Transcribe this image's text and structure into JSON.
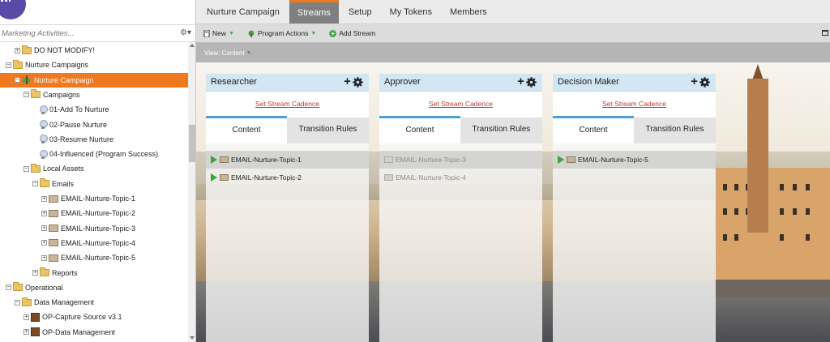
{
  "sidebar": {
    "search_placeholder": "Marketing Activities...",
    "tree": [
      {
        "label": "DO NOT MODIFY!",
        "indent": 2,
        "icon": "folder",
        "toggle": "+"
      },
      {
        "label": "Nurture Campaigns",
        "indent": 1,
        "icon": "folder",
        "toggle": "-"
      },
      {
        "label": "Nurture Campaign",
        "indent": 2,
        "icon": "nurture",
        "toggle": "-",
        "selected": true
      },
      {
        "label": "Campaigns",
        "indent": 3,
        "icon": "folder",
        "toggle": "-"
      },
      {
        "label": "01-Add To Nurture",
        "indent": 4,
        "icon": "bulb"
      },
      {
        "label": "02-Pause Nurture",
        "indent": 4,
        "icon": "bulb"
      },
      {
        "label": "03-Resume Nurture",
        "indent": 4,
        "icon": "bulb"
      },
      {
        "label": "04-Influenced (Program Success)",
        "indent": 4,
        "icon": "bulb"
      },
      {
        "label": "Local Assets",
        "indent": 3,
        "icon": "folder",
        "toggle": "-"
      },
      {
        "label": "Emails",
        "indent": 4,
        "icon": "folder",
        "toggle": "-"
      },
      {
        "label": "EMAIL-Nurture-Topic-1",
        "indent": 5,
        "icon": "email",
        "toggle": "+"
      },
      {
        "label": "EMAIL-Nurture-Topic-2",
        "indent": 5,
        "icon": "email",
        "toggle": "+"
      },
      {
        "label": "EMAIL-Nurture-Topic-3",
        "indent": 5,
        "icon": "email",
        "toggle": "+"
      },
      {
        "label": "EMAIL-Nurture-Topic-4",
        "indent": 5,
        "icon": "email",
        "toggle": "+"
      },
      {
        "label": "EMAIL-Nurture-Topic-5",
        "indent": 5,
        "icon": "email",
        "toggle": "+"
      },
      {
        "label": "Reports",
        "indent": 4,
        "icon": "folder",
        "toggle": "+"
      },
      {
        "label": "Operational",
        "indent": 1,
        "icon": "folder",
        "toggle": "-"
      },
      {
        "label": "Data Management",
        "indent": 2,
        "icon": "folder",
        "toggle": "-"
      },
      {
        "label": "OP-Capture Source v3.1",
        "indent": 3,
        "icon": "program",
        "toggle": "+"
      },
      {
        "label": "OP-Data Management",
        "indent": 3,
        "icon": "program",
        "toggle": "+"
      }
    ]
  },
  "nav": {
    "tabs": [
      {
        "label": "Nurture Campaign",
        "active": false
      },
      {
        "label": "Streams",
        "active": true
      },
      {
        "label": "Setup",
        "active": false
      },
      {
        "label": "My Tokens",
        "active": false
      },
      {
        "label": "Members",
        "active": false
      }
    ]
  },
  "toolbar": {
    "new_label": "New",
    "program_actions_label": "Program Actions",
    "add_stream_label": "Add Stream"
  },
  "viewbar": {
    "label": "View: Content"
  },
  "streams": [
    {
      "title": "Researcher",
      "cadence_label": "Set Stream Cadence",
      "tab_content": "Content",
      "tab_rules": "Transition Rules",
      "items": [
        {
          "label": "EMAIL-Nurture-Topic-1",
          "active": true
        },
        {
          "label": "EMAIL-Nurture-Topic-2",
          "active": true
        }
      ]
    },
    {
      "title": "Approver",
      "cadence_label": "Set Stream Cadence",
      "tab_content": "Content",
      "tab_rules": "Transition Rules",
      "items": [
        {
          "label": "EMAIL-Nurture-Topic-3",
          "active": false
        },
        {
          "label": "EMAIL-Nurture-Topic-4",
          "active": false
        }
      ]
    },
    {
      "title": "Decision Maker",
      "cadence_label": "Set Stream Cadence",
      "tab_content": "Content",
      "tab_rules": "Transition Rules",
      "items": [
        {
          "label": "EMAIL-Nurture-Topic-5",
          "active": true
        }
      ]
    }
  ],
  "colors": {
    "accent": "#f0781e",
    "card_header": "#d2e6f4",
    "tab_indicator": "#4aa0d6",
    "link": "#c0392b",
    "active_green": "#3aa63a"
  }
}
